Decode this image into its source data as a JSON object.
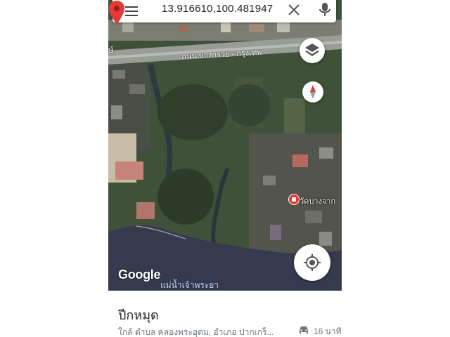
{
  "search": {
    "query": "13.916610,100.481947"
  },
  "map": {
    "road_label": "ถนน บางกรวย - กรุงเทพ",
    "edge_label": "ษ์",
    "poi_label": "วัดบางจาก",
    "river_label": "แม่น้ำเจ้าพระยา",
    "logo": "Google",
    "pin_color": "#e53935"
  },
  "place": {
    "name": "ปีกหมุด",
    "address": "ใกล้ ตำบล คลองพระอุดม, อำเภอ ปากเกร็...",
    "drive_time": "16 นาที"
  },
  "icons": [
    "menu-icon",
    "close-icon",
    "mic-icon",
    "layers-icon",
    "compass-icon",
    "my-location-icon",
    "car-icon"
  ]
}
